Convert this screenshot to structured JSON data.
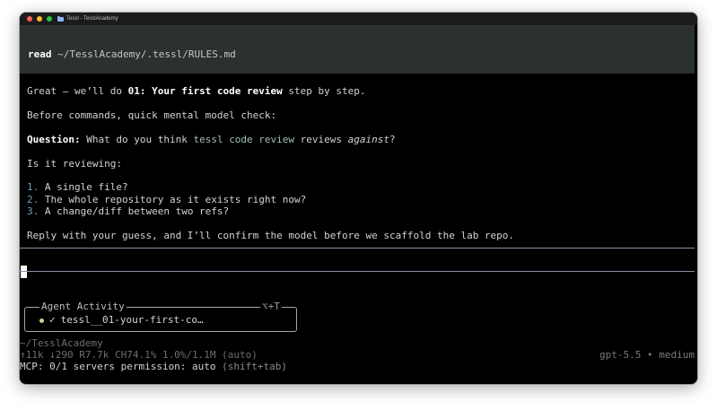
{
  "window": {
    "title": "Tessl - TesslAcademy"
  },
  "read": {
    "command": "read",
    "path": " ~/TesslAcademy/.tessl/RULES.md"
  },
  "message": {
    "l1_a": "Great — we’ll do ",
    "l1_b": "01: Your first code review",
    "l1_c": " step by step.",
    "l2": "Before commands, quick mental model check:",
    "q_label": "Question:",
    "q_a": " What do you think ",
    "q_code": "tessl code review",
    "q_b": " reviews ",
    "q_em": "against",
    "q_c": "?",
    "l4": "Is it reviewing:",
    "options": [
      {
        "n": "1.",
        "text": " A single file?"
      },
      {
        "n": "2.",
        "text": " The whole repository as it exists right now?"
      },
      {
        "n": "3.",
        "text": " A change/diff between two refs?"
      }
    ],
    "reply": "Reply with your guess, and I’ll confirm the model before we scaffold the lab repo."
  },
  "agent": {
    "title": "Agent Activity",
    "hotkey": "⌥+T",
    "item": "tessl__01-your-first-co…"
  },
  "status": {
    "cwd": "~/TesslAcademy",
    "tokens": "↑11k ↓290 R7.7k CH74.1% 1.0%/1.1M (auto)",
    "model": "gpt-5.5 • medium",
    "mcp_a": "MCP: 0/1 servers permission: auto",
    "mcp_b": " (shift+tab)"
  },
  "colors": {
    "read_bar": "#2b312d",
    "accent_dot": "#c9d48a",
    "separator": "#8a8fa3"
  }
}
